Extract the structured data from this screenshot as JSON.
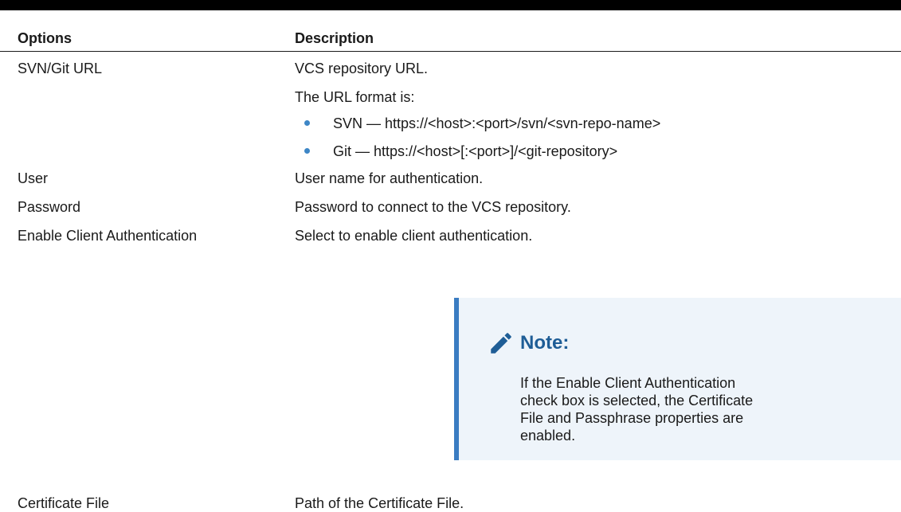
{
  "table": {
    "headers": {
      "options": "Options",
      "description": "Description"
    },
    "rows": [
      {
        "option": "SVN/Git URL",
        "description": "VCS repository URL.",
        "extra": "The URL format is:",
        "bullets": [
          "SVN — https://<host>:<port>/svn/<svn-repo-name>",
          "Git — https://<host>[:<port>]/<git-repository>"
        ]
      },
      {
        "option": "User",
        "description": "User name for authentication."
      },
      {
        "option": "Password",
        "description": "Password to connect to the VCS repository."
      },
      {
        "option": "Enable Client Authentication",
        "description": "Select to enable client authentication."
      },
      {
        "option": "Certificate File",
        "description": "Path of the Certificate File."
      }
    ]
  },
  "note": {
    "icon": "pencil-icon",
    "title": "Note:",
    "body": "If the Enable Client Authentication check box is selected, the Certificate File and Passphrase properties are enabled.",
    "accent_color": "#3a7cc2",
    "background_color": "#eef4fa",
    "title_color": "#1e5d96"
  },
  "colors": {
    "bullet": "#3d86c6",
    "top_rule": "#000000"
  }
}
